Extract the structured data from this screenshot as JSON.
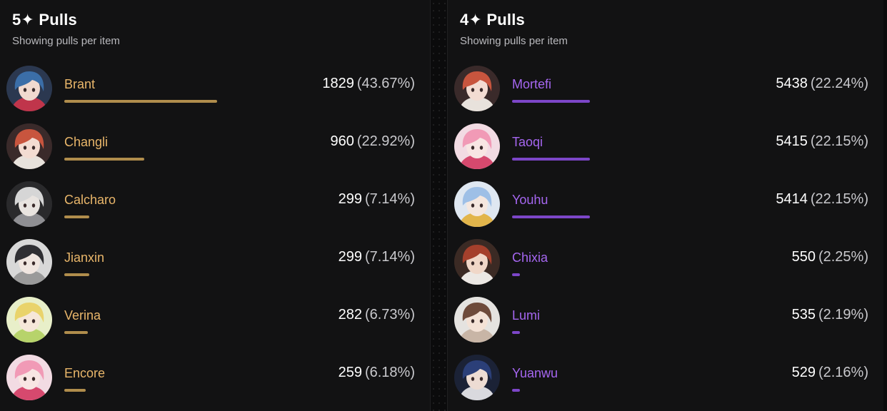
{
  "panels": [
    {
      "title": "5✦ Pulls",
      "subtitle": "Showing pulls per item",
      "accent_name": "#e9b66a",
      "accent_bar": "#b08d4c",
      "items": [
        {
          "name": "Brant",
          "count": "1829",
          "percent": "(43.67%)",
          "share": 0.4367,
          "avatar": "blue-hair-avatar"
        },
        {
          "name": "Changli",
          "count": "960",
          "percent": "(22.92%)",
          "share": 0.2292,
          "avatar": "red-hair-avatar"
        },
        {
          "name": "Calcharo",
          "count": "299",
          "percent": "(7.14%)",
          "share": 0.0714,
          "avatar": "white-hair-avatar"
        },
        {
          "name": "Jianxin",
          "count": "299",
          "percent": "(7.14%)",
          "share": 0.0714,
          "avatar": "dark-hair-avatar"
        },
        {
          "name": "Verina",
          "count": "282",
          "percent": "(6.73%)",
          "share": 0.0673,
          "avatar": "blonde-hair-avatar"
        },
        {
          "name": "Encore",
          "count": "259",
          "percent": "(6.18%)",
          "share": 0.0618,
          "avatar": "pink-hair-avatar"
        }
      ]
    },
    {
      "title": "4✦ Pulls",
      "subtitle": "Showing pulls per item",
      "accent_name": "#a566f0",
      "accent_bar": "#7c46c8",
      "items": [
        {
          "name": "Mortefi",
          "count": "5438",
          "percent": "(22.24%)",
          "share": 0.2224,
          "avatar": "red-hair-avatar"
        },
        {
          "name": "Taoqi",
          "count": "5415",
          "percent": "(22.15%)",
          "share": 0.2215,
          "avatar": "pink-hair-avatar"
        },
        {
          "name": "Youhu",
          "count": "5414",
          "percent": "(22.15%)",
          "share": 0.2215,
          "avatar": "light-blue-hair-avatar"
        },
        {
          "name": "Chixia",
          "count": "550",
          "percent": "(2.25%)",
          "share": 0.0225,
          "avatar": "auburn-hair-avatar"
        },
        {
          "name": "Lumi",
          "count": "535",
          "percent": "(2.19%)",
          "share": 0.0219,
          "avatar": "brown-hair-avatar"
        },
        {
          "name": "Yuanwu",
          "count": "529",
          "percent": "(2.16%)",
          "share": 0.0216,
          "avatar": "navy-hair-avatar"
        }
      ]
    }
  ]
}
